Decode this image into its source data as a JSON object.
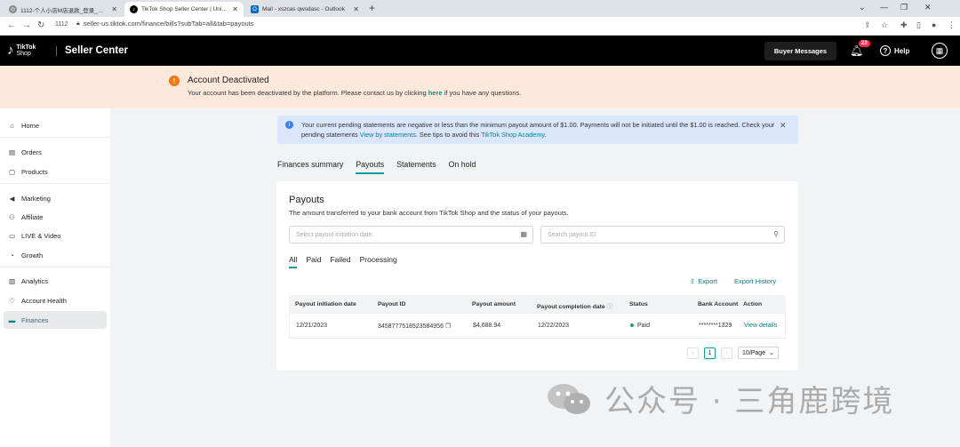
{
  "browser": {
    "tabs": [
      {
        "title": "1112-个人小店M店退款_登录_登录_(",
        "active": false
      },
      {
        "title": "TikTok Shop Seller Center | United S",
        "active": true
      },
      {
        "title": "Mail - xszcas qwsdasc - Outlook",
        "active": false
      }
    ],
    "new_tab": "+",
    "profile_label": "1112",
    "url": "seller-us.tiktok.com/finance/bills?subTab=all&tab=payouts"
  },
  "header": {
    "logo_line1": "TikTok",
    "logo_line2": "Shop",
    "title": "Seller Center",
    "buyer_messages": "Buyer Messages",
    "notification_count": "23",
    "help": "Help"
  },
  "banner": {
    "title": "Account Deactivated",
    "text_before": "Your account has been deactivated by the platform. Please contact us by clicking ",
    "link": "here",
    "text_after": " if you have any questions."
  },
  "sidebar": {
    "items": [
      {
        "label": "Home",
        "icon": "home-icon"
      },
      {
        "label": "Orders",
        "icon": "orders-icon"
      },
      {
        "label": "Products",
        "icon": "products-icon"
      },
      {
        "label": "Marketing",
        "icon": "marketing-icon"
      },
      {
        "label": "Affiliate",
        "icon": "affiliate-icon"
      },
      {
        "label": "LIVE & Video",
        "icon": "live-icon"
      },
      {
        "label": "Growth",
        "icon": "growth-icon"
      },
      {
        "label": "Analytics",
        "icon": "analytics-icon"
      },
      {
        "label": "Account Health",
        "icon": "health-icon"
      },
      {
        "label": "Finances",
        "icon": "finances-icon",
        "active": true
      }
    ]
  },
  "alert": {
    "text1": "Your current pending statements are negative or less than the minimum payout amount of $1.00. Payments will not be initiated until the $1.00 is reached. Check your pending statements ",
    "link1": "View by statements",
    "text2": ". See tips to avoid this ",
    "link2": "TikTok Shop Academy",
    "text3": "."
  },
  "top_tabs": [
    "Finances summary",
    "Payouts",
    "Statements",
    "On hold"
  ],
  "payouts": {
    "title": "Payouts",
    "subtitle": "The amount transferred to your bank account from TikTok Shop and the status of your payouts.",
    "date_placeholder": "Select payout initiation date",
    "search_placeholder": "Search payout ID",
    "sub_tabs": [
      "All",
      "Paid",
      "Failed",
      "Processing"
    ],
    "export": "Export",
    "export_history": "Export History",
    "columns": [
      "Payout initiation date",
      "Payout ID",
      "Payout amount",
      "Payout completion date",
      "Status",
      "Bank Account",
      "Action"
    ],
    "rows": [
      {
        "initiation_date": "12/21/2023",
        "payout_id": "3458777518523584956",
        "amount": "$4,688.94",
        "completion_date": "12/22/2023",
        "status": "Paid",
        "bank_account": "********1329",
        "action": "View details"
      }
    ],
    "pagination": {
      "prev": "‹",
      "current_page": "1",
      "next": "›",
      "page_size": "10/Page"
    }
  },
  "watermark": {
    "text": "公众号 · 三角鹿跨境"
  }
}
